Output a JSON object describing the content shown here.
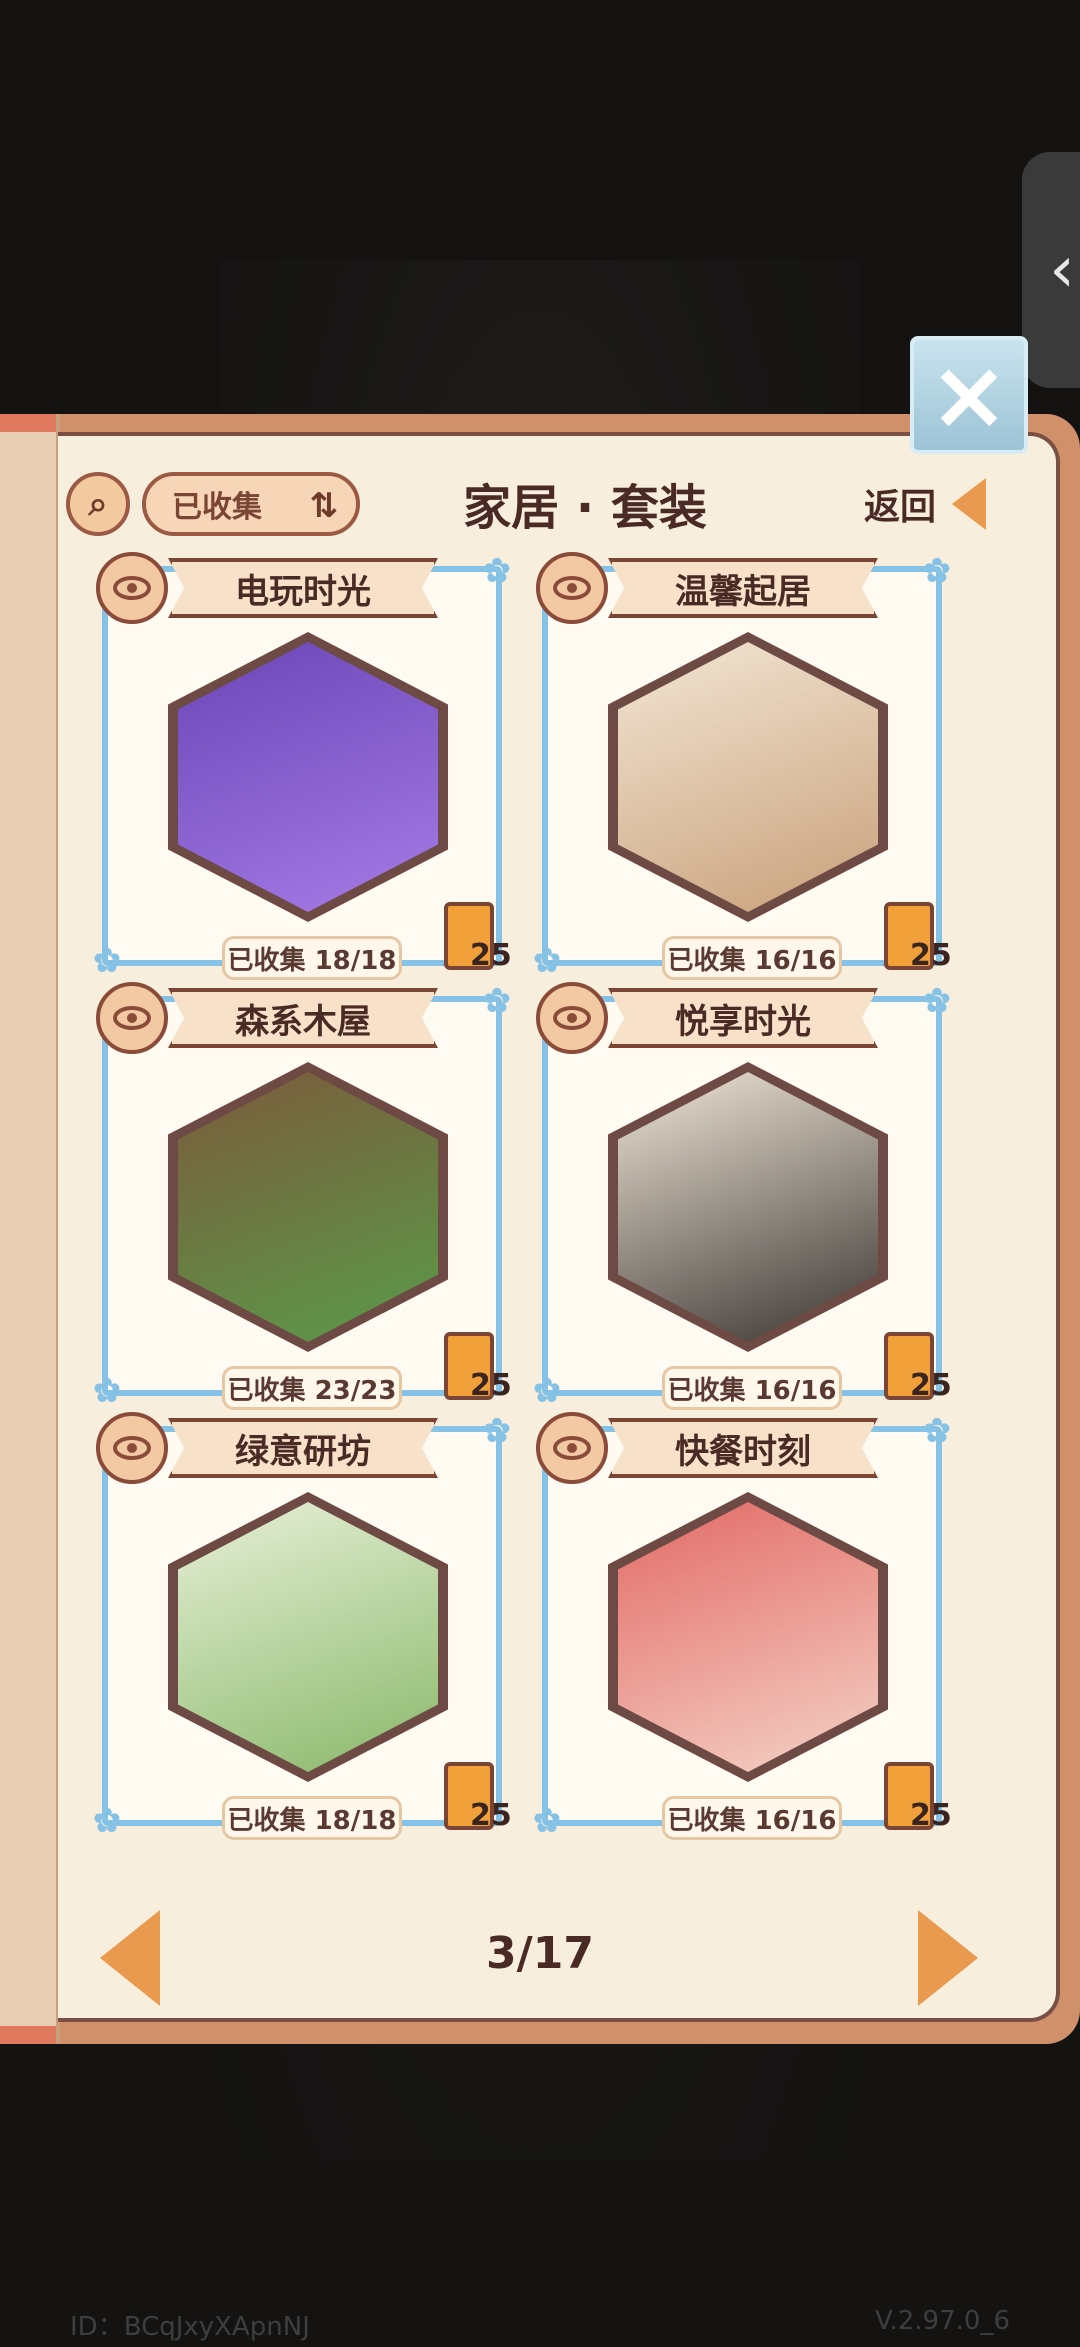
{
  "header": {
    "collected_label": "已收集",
    "sort_icon_text": "⇅",
    "title": "家居 · 套装",
    "back_label": "返回"
  },
  "close_icon": "×",
  "side_tab_icon": "‹",
  "cards": [
    {
      "title": "电玩时光",
      "count": "已收集 18/18",
      "points": "25",
      "colors": [
        "#6b46b8",
        "#a57be6"
      ]
    },
    {
      "title": "温馨起居",
      "count": "已收集 16/16",
      "points": "25",
      "colors": [
        "#f2e6d4",
        "#c9a07a"
      ]
    },
    {
      "title": "森系木屋",
      "count": "已收集 23/23",
      "points": "25",
      "colors": [
        "#7c5a3b",
        "#5a9b4a"
      ]
    },
    {
      "title": "悦享时光",
      "count": "已收集 16/16",
      "points": "25",
      "colors": [
        "#efe6d6",
        "#3c3633"
      ]
    },
    {
      "title": "绿意研坊",
      "count": "已收集 18/18",
      "points": "25",
      "colors": [
        "#e8f0d8",
        "#89b86a"
      ]
    },
    {
      "title": "快餐时刻",
      "count": "已收集 16/16",
      "points": "25",
      "colors": [
        "#e36a66",
        "#f4d2c6"
      ]
    }
  ],
  "pagination": {
    "text": "3/17"
  },
  "footer": {
    "id": "ID：BCqJxyXApnNJ",
    "version": "V.2.97.0_6"
  }
}
